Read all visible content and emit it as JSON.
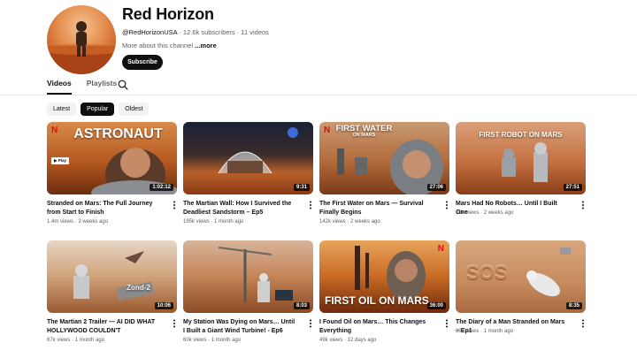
{
  "channel": {
    "name": "Red Horizon",
    "handle": "@RedHorizonUSA",
    "subscribers": "12.6k subscribers",
    "video_count": "11 videos",
    "meta_sep": " · ",
    "about": "More about this channel",
    "more": "...more",
    "subscribe_label": "Subscribe"
  },
  "tabs": [
    {
      "label": "Videos",
      "active": true
    },
    {
      "label": "Playlists",
      "active": false
    }
  ],
  "chips": [
    {
      "label": "Latest",
      "active": false
    },
    {
      "label": "Popular",
      "active": true
    },
    {
      "label": "Oldest",
      "active": false
    }
  ],
  "videos": [
    {
      "title": "Stranded on Mars: The Full Journey from Start to Finish",
      "views": "1.4m views",
      "age": "3 weeks ago",
      "duration": "1:02:12",
      "thumb_text": "ASTRONAUT",
      "thumb_label": "Play",
      "netflix": "N"
    },
    {
      "title": "The Martian Wall: How I Survived the Deadliest Sandstorm – Ep5",
      "views": "195k views",
      "age": "1 month ago",
      "duration": "9:31",
      "thumb_text": ""
    },
    {
      "title": "The First Water on Mars — Survival Finally Begins",
      "views": "142k views",
      "age": "2 weeks ago",
      "duration": "27:06",
      "thumb_text": "FIRST WATER",
      "thumb_sub": "ON MARS",
      "netflix": "N"
    },
    {
      "title": "Mars Had No Robots… Until I Built One",
      "views": "81k views",
      "age": "2 weeks ago",
      "duration": "27:51",
      "thumb_text": "FIRST ROBOT ON MARS"
    },
    {
      "title": "The Martian 2 Trailer — AI DID WHAT HOLLYWOOD COULDN'T",
      "views": "67k views",
      "age": "1 month ago",
      "duration": "10:06",
      "thumb_text": "Zond-2"
    },
    {
      "title": "My Station Was Dying on Mars… Until I Built a Giant Wind Turbine! - Ep6",
      "views": "60k views",
      "age": "1 month ago",
      "duration": "8:03",
      "thumb_text": ""
    },
    {
      "title": "I Found Oil on Mars… This Changes Everything",
      "views": "49k views",
      "age": "12 days ago",
      "duration": "36:00",
      "thumb_text": "FIRST OIL ON MARS",
      "netflix": "N"
    },
    {
      "title": "The Diary of a Man Stranded on Mars – Ep1",
      "views": "39k views",
      "age": "1 month ago",
      "duration": "8:35",
      "thumb_text": "SOS"
    }
  ],
  "icons": {
    "search": "search-icon",
    "more": "more-vert-icon"
  },
  "colors": {
    "accent": "#0f0f0f",
    "netflix": "#e50914",
    "mars": "#c2571f"
  }
}
